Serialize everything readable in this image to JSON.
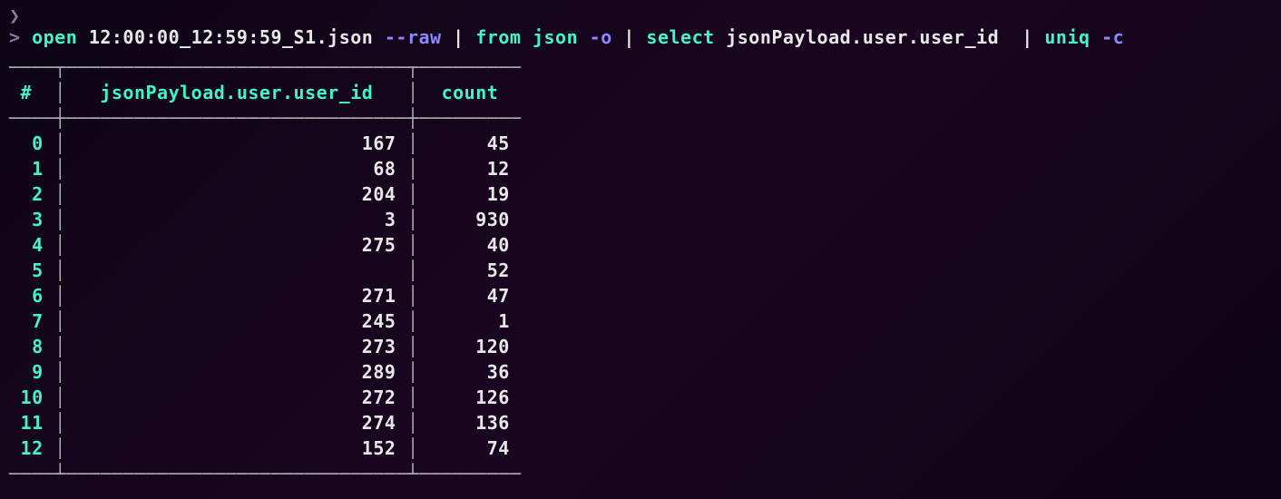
{
  "prompt": {
    "prev_caret": "❯",
    "caret": ">",
    "parts": {
      "cmd1": "open",
      "file": "12:00:00_12:59:59_S1.json",
      "flag1": "--raw",
      "pipe": "|",
      "cmd2": "from json",
      "flag2": "-o",
      "cmd3": "select",
      "field": "jsonPayload.user.user_id",
      "cmd4": "uniq",
      "flag3": "-c"
    }
  },
  "table": {
    "headers": {
      "hash": "#",
      "uid": "jsonPayload.user.user_id",
      "count": "count"
    },
    "rows": [
      {
        "idx": "0",
        "uid": "167",
        "count": "45"
      },
      {
        "idx": "1",
        "uid": "68",
        "count": "12"
      },
      {
        "idx": "2",
        "uid": "204",
        "count": "19"
      },
      {
        "idx": "3",
        "uid": "3",
        "count": "930"
      },
      {
        "idx": "4",
        "uid": "275",
        "count": "40"
      },
      {
        "idx": "5",
        "uid": "",
        "count": "52"
      },
      {
        "idx": "6",
        "uid": "271",
        "count": "47"
      },
      {
        "idx": "7",
        "uid": "245",
        "count": "1"
      },
      {
        "idx": "8",
        "uid": "273",
        "count": "120"
      },
      {
        "idx": "9",
        "uid": "289",
        "count": "36"
      },
      {
        "idx": "10",
        "uid": "272",
        "count": "126"
      },
      {
        "idx": "11",
        "uid": "274",
        "count": "136"
      },
      {
        "idx": "12",
        "uid": "152",
        "count": "74"
      }
    ]
  }
}
